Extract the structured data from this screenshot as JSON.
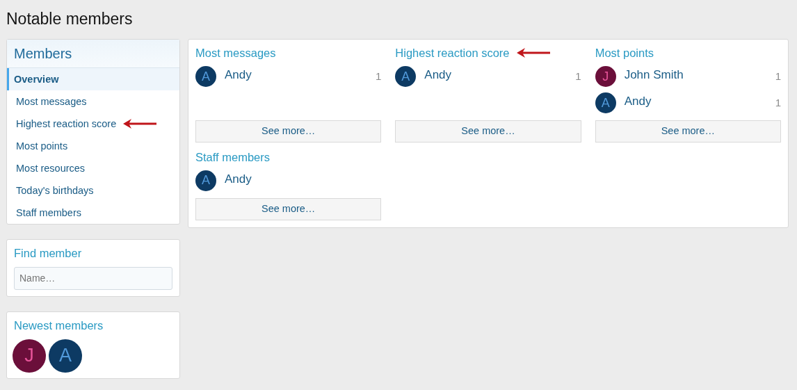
{
  "page_title": "Notable members",
  "sidebar": {
    "title": "Members",
    "items": [
      {
        "label": "Overview",
        "selected": true,
        "arrow": false
      },
      {
        "label": "Most messages",
        "selected": false,
        "arrow": false
      },
      {
        "label": "Highest reaction score",
        "selected": false,
        "arrow": true
      },
      {
        "label": "Most points",
        "selected": false,
        "arrow": false
      },
      {
        "label": "Most resources",
        "selected": false,
        "arrow": false
      },
      {
        "label": "Today's birthdays",
        "selected": false,
        "arrow": false
      },
      {
        "label": "Staff members",
        "selected": false,
        "arrow": false
      }
    ]
  },
  "find_member": {
    "title": "Find member",
    "placeholder": "Name…"
  },
  "newest_members": {
    "title": "Newest members",
    "avatars": [
      {
        "letter": "J",
        "color": "#6b0f3a"
      },
      {
        "letter": "A",
        "color": "#0d3a63"
      }
    ]
  },
  "sections": [
    {
      "title": "Most messages",
      "arrow": false,
      "button": "See more…",
      "members": [
        {
          "letter": "A",
          "color": "#0d3a63",
          "name": "Andy",
          "count": "1"
        }
      ]
    },
    {
      "title": "Highest reaction score",
      "arrow": true,
      "button": "See more…",
      "members": [
        {
          "letter": "A",
          "color": "#0d3a63",
          "name": "Andy",
          "count": "1"
        }
      ]
    },
    {
      "title": "Most points",
      "arrow": false,
      "button": "See more…",
      "members": [
        {
          "letter": "J",
          "color": "#6b0f3a",
          "name": "John Smith",
          "count": "1"
        },
        {
          "letter": "A",
          "color": "#0d3a63",
          "name": "Andy",
          "count": "1"
        }
      ]
    },
    {
      "title": "Staff members",
      "arrow": false,
      "button": "See more…",
      "members": [
        {
          "letter": "A",
          "color": "#0d3a63",
          "name": "Andy"
        }
      ]
    }
  ]
}
